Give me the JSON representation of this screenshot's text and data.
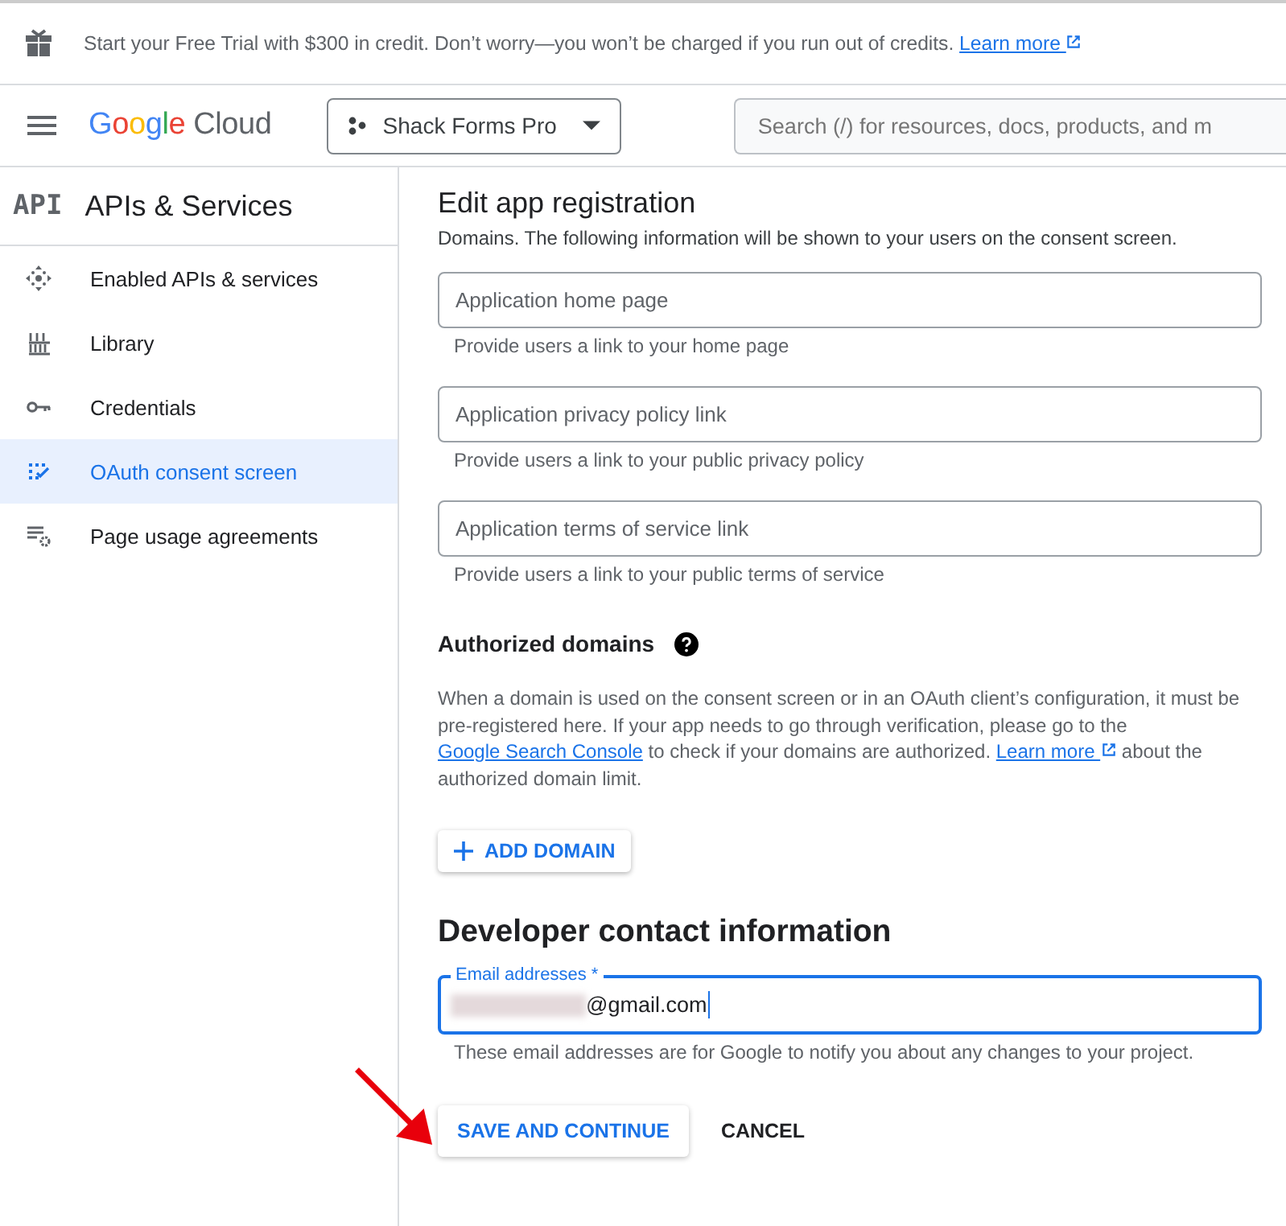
{
  "banner": {
    "text": "Start your Free Trial with $300 in credit. Don’t worry—you won’t be charged if you run out of credits.",
    "link": "Learn more"
  },
  "header": {
    "logo_brand": "Google",
    "logo_product": "Cloud",
    "project": "Shack Forms Pro",
    "search": {
      "placeholder": "Search (/) for resources, docs, products, and m"
    }
  },
  "sidebar": {
    "badge": "API",
    "title": "APIs & Services",
    "items": [
      {
        "label": "Enabled APIs & services",
        "selected": false
      },
      {
        "label": "Library",
        "selected": false
      },
      {
        "label": "Credentials",
        "selected": false
      },
      {
        "label": "OAuth consent screen",
        "selected": true
      },
      {
        "label": "Page usage agreements",
        "selected": false
      }
    ]
  },
  "main": {
    "title": "Edit app registration",
    "intro": "Domains. The following information will be shown to your users on the consent screen.",
    "fields": [
      {
        "placeholder": "Application home page",
        "hint": "Provide users a link to your home page"
      },
      {
        "placeholder": "Application privacy policy link",
        "hint": "Provide users a link to your public privacy policy"
      },
      {
        "placeholder": "Application terms of service link",
        "hint": "Provide users a link to your public terms of service"
      }
    ],
    "domains": {
      "title": "Authorized domains",
      "text_1": "When a domain is used on the consent screen or in an OAuth client’s configuration, it must be pre-registered here. If your app needs to go through verification, please go to the",
      "link_1": "Google Search Console",
      "text_2": "to check if your domains are authorized.",
      "link_2": "Learn more",
      "text_3": "about the authorized domain limit.",
      "button": "ADD DOMAIN"
    },
    "contact": {
      "title": "Developer contact information",
      "label": "Email addresses *",
      "value": "@gmail.com",
      "hint": "These email addresses are for Google to notify you about any changes to your project."
    },
    "buttons": [
      {
        "label": "SAVE AND CONTINUE",
        "kind": "raised"
      },
      {
        "label": "CANCEL",
        "kind": "text"
      }
    ]
  }
}
